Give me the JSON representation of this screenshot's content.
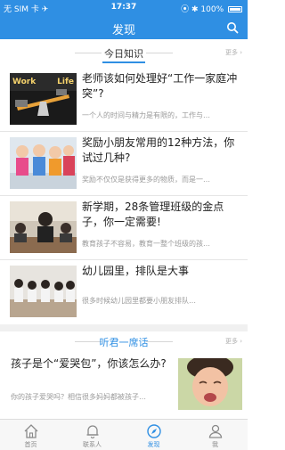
{
  "status_bar": {
    "carrier": "无 SIM 卡 ✈",
    "time": "17:37",
    "battery_text": "⦿ ✱ 100%"
  },
  "nav": {
    "title": "发现"
  },
  "section_today": {
    "title": "今日知识",
    "more": "更多 ›"
  },
  "articles": [
    {
      "title": "老师该如何处理好“工作一家庭冲突”?",
      "summary": "一个人的时间与精力是有限的，工作与…",
      "thumb_label_left": "Work",
      "thumb_label_right": "Life"
    },
    {
      "title": "奖励小朋友常用的12种方法，你试过几种?",
      "summary": "奖励不仅仅是获得更多的物质，而是一…"
    },
    {
      "title": "新学期，28条管理班级的金点子，你一定需要!",
      "summary": "教育孩子不容易，教育一整个班级的孩…"
    },
    {
      "title": "幼儿园里，排队是大事",
      "summary": "很多时候幼儿园里都要小朋友排队…"
    }
  ],
  "section_talk": {
    "title": "听君一席话",
    "more": "更多 ›"
  },
  "story": {
    "title": "孩子是个“爱哭包”，你该怎么办?",
    "summary": "你的孩子爱哭吗？相信很多妈妈都被孩子…"
  },
  "tabs": [
    {
      "label": "首页",
      "icon": "home-icon"
    },
    {
      "label": "联系人",
      "icon": "bell-icon"
    },
    {
      "label": "发现",
      "icon": "compass-icon"
    },
    {
      "label": "我",
      "icon": "person-icon"
    }
  ],
  "colors": {
    "accent": "#2f8fe3",
    "title_text": "#222222",
    "summary_text": "#9a9a9a"
  }
}
